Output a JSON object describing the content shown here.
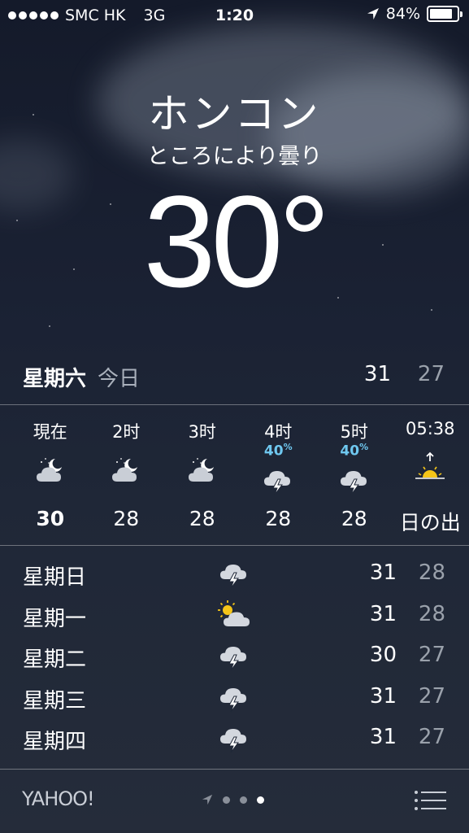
{
  "status_bar": {
    "carrier": "SMC HK",
    "network": "3G",
    "time": "1:20",
    "battery": "84%",
    "battery_level": 0.84
  },
  "location": {
    "city": "ホンコン",
    "condition": "ところにより曇り",
    "temperature": "30°"
  },
  "today": {
    "day": "星期六",
    "label": "今日",
    "high": "31",
    "low": "27"
  },
  "hourly": [
    {
      "time": "現在",
      "icon": "partly-cloudy-night-icon",
      "temp": "30"
    },
    {
      "time": "2时",
      "icon": "partly-cloudy-night-icon",
      "temp": "28"
    },
    {
      "time": "3时",
      "icon": "partly-cloudy-night-icon",
      "temp": "28"
    },
    {
      "time": "4时",
      "precip": "40",
      "precip_unit": "%",
      "icon": "thunderstorm-icon",
      "temp": "28"
    },
    {
      "time": "5时",
      "precip": "40",
      "precip_unit": "%",
      "icon": "thunderstorm-icon",
      "temp": "28"
    },
    {
      "time": "05:38",
      "icon": "sunrise-icon",
      "temp": "日の出"
    }
  ],
  "daily": [
    {
      "day": "星期日",
      "icon": "thunderstorm-icon",
      "high": "31",
      "low": "28"
    },
    {
      "day": "星期一",
      "icon": "partly-sunny-icon",
      "high": "31",
      "low": "28"
    },
    {
      "day": "星期二",
      "icon": "thunderstorm-icon",
      "high": "30",
      "low": "27"
    },
    {
      "day": "星期三",
      "icon": "thunderstorm-icon",
      "high": "31",
      "low": "27"
    },
    {
      "day": "星期四",
      "icon": "thunderstorm-icon",
      "high": "31",
      "low": "27"
    }
  ],
  "footer": {
    "brand": "YAHOO!",
    "pages": 3,
    "active_page": 3
  },
  "colors": {
    "precip": "#6fc8f0",
    "sun": "#f5c518"
  }
}
